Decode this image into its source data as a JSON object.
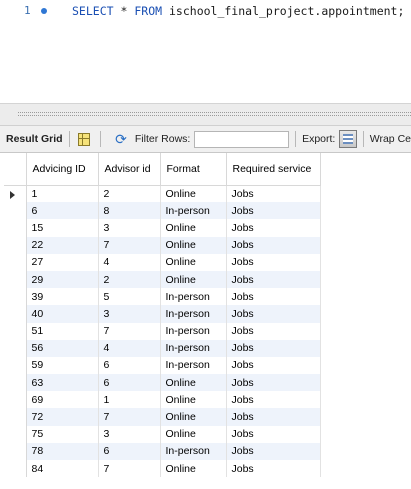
{
  "editor": {
    "line_number": "1",
    "sql_keyword_select": "SELECT",
    "sql_star": "*",
    "sql_keyword_from": "FROM",
    "sql_table": "ischool_final_project.appointment;"
  },
  "toolbar": {
    "result_grid_label": "Result Grid",
    "filter_rows_label": "Filter Rows:",
    "filter_rows_value": "",
    "export_label": "Export:",
    "wrap_label": "Wrap Ce"
  },
  "grid": {
    "columns": [
      "Advicing ID",
      "Advisor id",
      "Format",
      "Required service"
    ],
    "rows": [
      [
        "1",
        "2",
        "Online",
        "Jobs"
      ],
      [
        "6",
        "8",
        "In-person",
        "Jobs"
      ],
      [
        "15",
        "3",
        "Online",
        "Jobs"
      ],
      [
        "22",
        "7",
        "Online",
        "Jobs"
      ],
      [
        "27",
        "4",
        "Online",
        "Jobs"
      ],
      [
        "29",
        "2",
        "Online",
        "Jobs"
      ],
      [
        "39",
        "5",
        "In-person",
        "Jobs"
      ],
      [
        "40",
        "3",
        "In-person",
        "Jobs"
      ],
      [
        "51",
        "7",
        "In-person",
        "Jobs"
      ],
      [
        "56",
        "4",
        "In-person",
        "Jobs"
      ],
      [
        "59",
        "6",
        "In-person",
        "Jobs"
      ],
      [
        "63",
        "6",
        "Online",
        "Jobs"
      ],
      [
        "69",
        "1",
        "Online",
        "Jobs"
      ],
      [
        "72",
        "7",
        "Online",
        "Jobs"
      ],
      [
        "75",
        "3",
        "Online",
        "Jobs"
      ],
      [
        "78",
        "6",
        "In-person",
        "Jobs"
      ],
      [
        "84",
        "7",
        "Online",
        "Jobs"
      ]
    ]
  },
  "colors": {
    "keyword": "#1a4fb3",
    "row_alt": "#eef3fb",
    "toolbar_bg": "#f0f0f0"
  }
}
